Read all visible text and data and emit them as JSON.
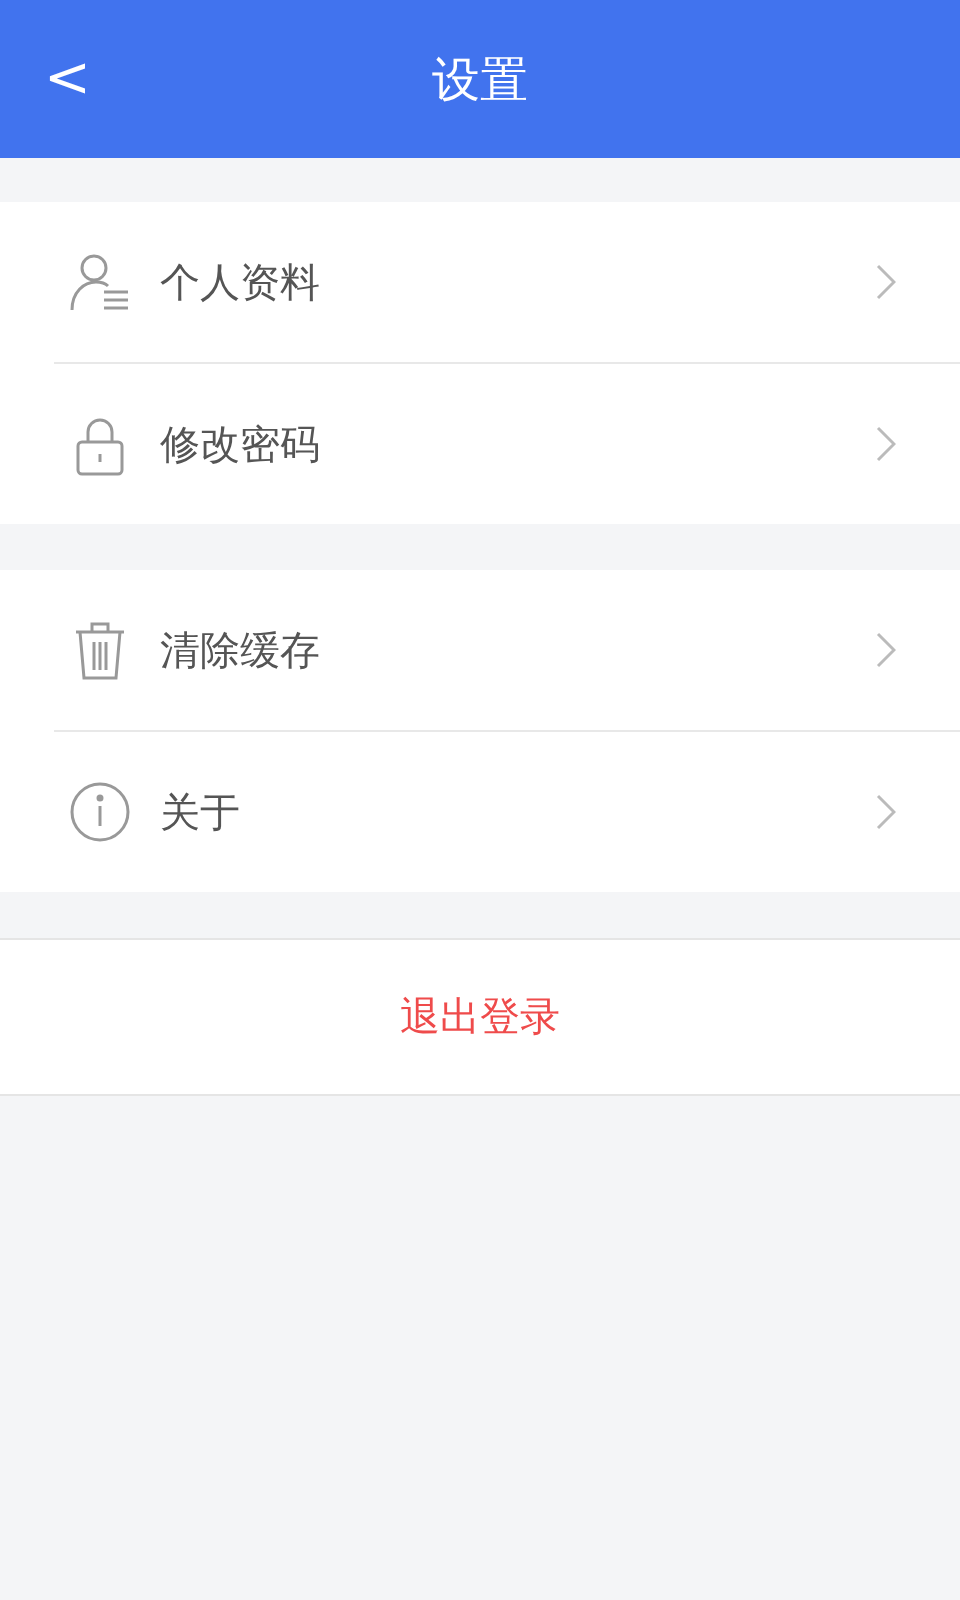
{
  "header": {
    "back": "<",
    "title": "设置"
  },
  "groups": [
    {
      "items": [
        {
          "kind": "profile",
          "label": "个人资料"
        },
        {
          "kind": "lock",
          "label": "修改密码"
        }
      ]
    },
    {
      "items": [
        {
          "kind": "trash",
          "label": "清除缓存"
        },
        {
          "kind": "info",
          "label": "关于"
        }
      ]
    }
  ],
  "logout": {
    "label": "退出登录"
  }
}
